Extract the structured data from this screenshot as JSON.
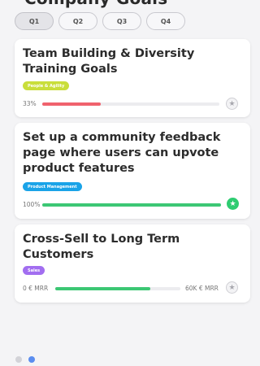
{
  "header": {
    "title": "Company Goals"
  },
  "tabs": [
    {
      "label": "Q1",
      "active": true
    },
    {
      "label": "Q2",
      "active": false
    },
    {
      "label": "Q3",
      "active": false
    },
    {
      "label": "Q4",
      "active": false
    }
  ],
  "goals": [
    {
      "title": "Team Building & Diversity Training Goals",
      "tag": "People & Agility",
      "tag_color": "#c9de3b",
      "left_label": "33%",
      "right_label": "",
      "progress": 0.33,
      "bar_color": "#f0626d",
      "starred": false,
      "star_icon": "star-icon"
    },
    {
      "title": "Set up a community feedback page where users can upvote product features",
      "tag": "Product Management",
      "tag_color": "#1aa3e8",
      "left_label": "100%",
      "right_label": "",
      "progress": 1.0,
      "bar_color": "#3cc774",
      "starred": true,
      "star_icon": "star-icon"
    },
    {
      "title": "Cross-Sell to Long Term Customers",
      "tag": "Sales",
      "tag_color": "#a26ef0",
      "left_label": "0 € MRR",
      "right_label": "60K € MRR",
      "progress": 0.76,
      "bar_color": "#3cc774",
      "starred": false,
      "star_icon": "star-icon"
    }
  ],
  "pagination": {
    "dot_colors": [
      "#d3d3d8",
      "#5b8def"
    ],
    "active_index": 1
  }
}
